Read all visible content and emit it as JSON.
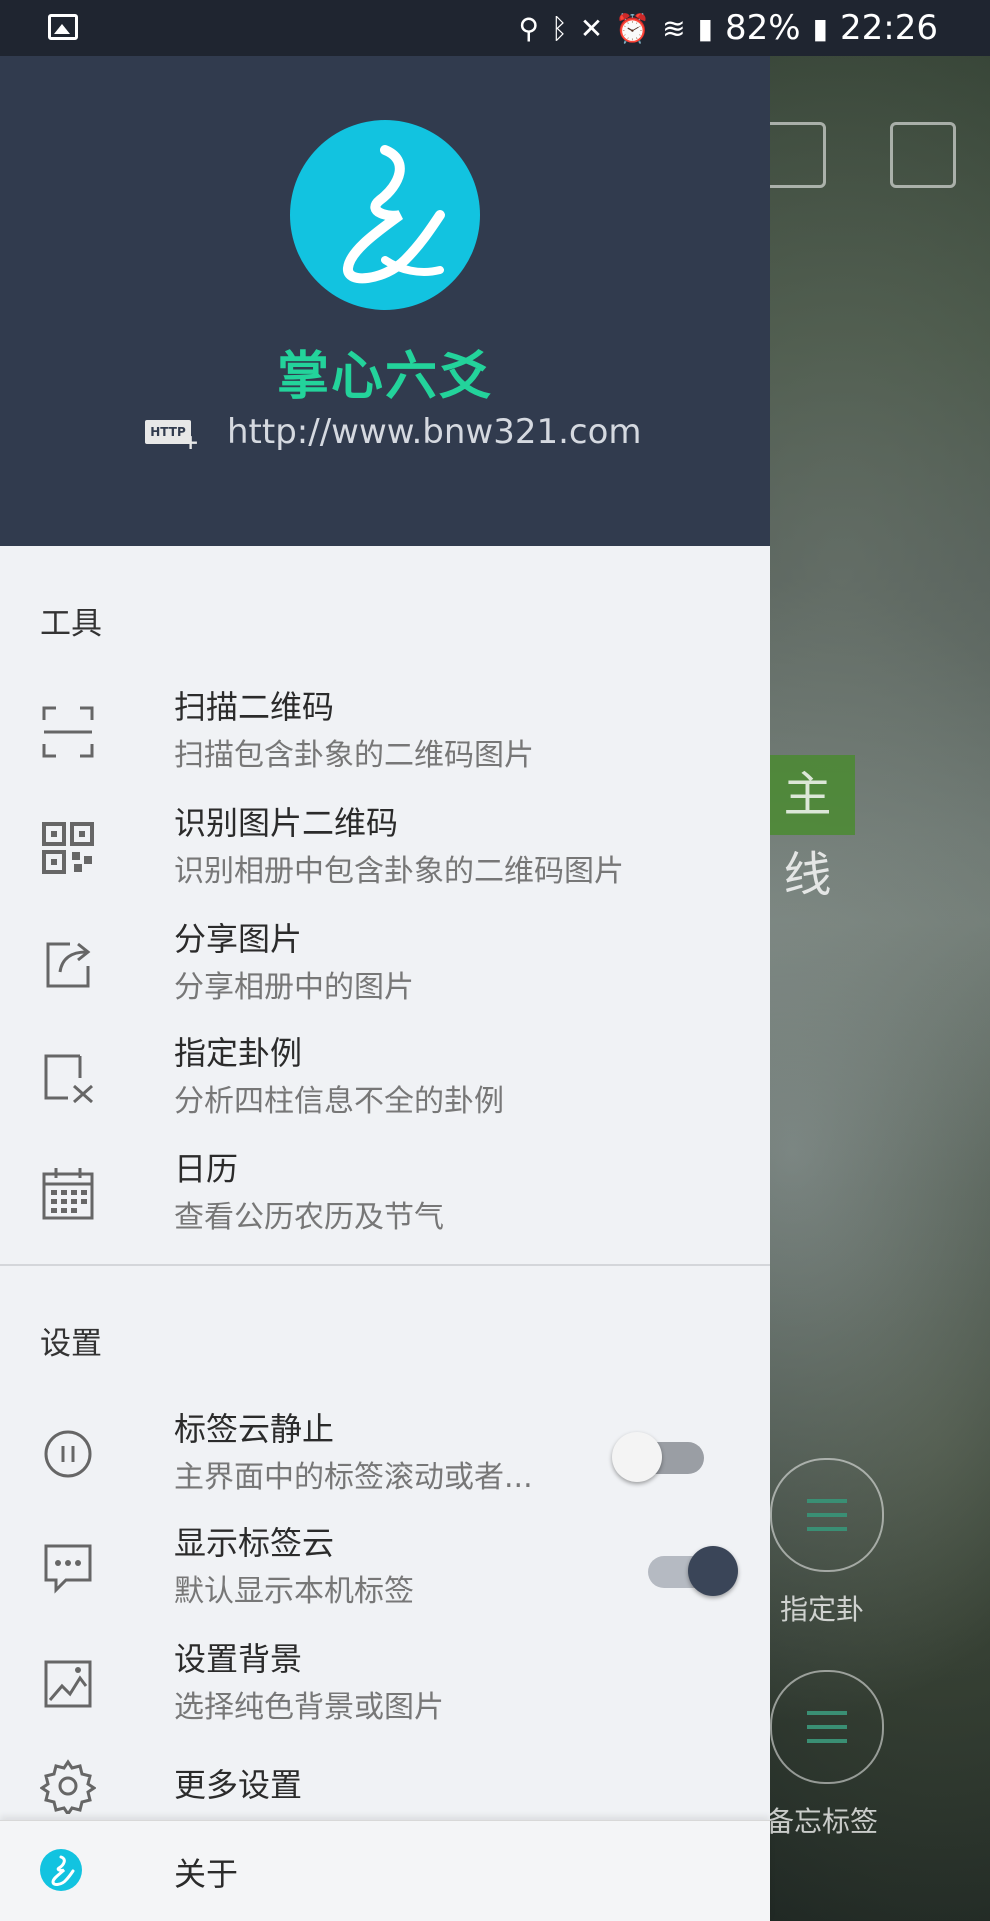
{
  "status_bar": {
    "battery": "82%",
    "time": "22:26"
  },
  "drawer": {
    "app_name": "掌心六爻",
    "url": "http://www.bnw321.com",
    "http_badge": "HTTP",
    "tools": {
      "title": "工具",
      "items": [
        {
          "icon": "scan-frame-icon",
          "title": "扫描二维码",
          "sub": "扫描包含卦象的二维码图片"
        },
        {
          "icon": "qr-code-icon",
          "title": "识别图片二维码",
          "sub": "识别相册中包含卦象的二维码图片"
        },
        {
          "icon": "share-icon",
          "title": "分享图片",
          "sub": "分享相册中的图片"
        },
        {
          "icon": "designate-icon",
          "title": "指定卦例",
          "sub": "分析四柱信息不全的卦例"
        },
        {
          "icon": "calendar-icon",
          "title": "日历",
          "sub": "查看公历农历及节气"
        }
      ]
    },
    "settings": {
      "title": "设置",
      "items": [
        {
          "icon": "pause-icon",
          "title": "标签云静止",
          "sub": "主界面中的标签滚动或者...",
          "toggle": false
        },
        {
          "icon": "chat-icon",
          "title": "显示标签云",
          "sub": "默认显示本机标签",
          "toggle": true
        },
        {
          "icon": "image-icon",
          "title": "设置背景",
          "sub": "选择纯色背景或图片"
        },
        {
          "icon": "gear-icon",
          "title": "更多设置"
        }
      ]
    },
    "about_label": "关于"
  },
  "background": {
    "green_label": "主线",
    "button1": "指定卦",
    "button2": "备忘标签"
  },
  "colors": {
    "header_bg": "#313b4e",
    "accent_cyan": "#12c3e0",
    "app_name_green": "#23d39b",
    "drawer_bg": "#f0f2f5"
  }
}
